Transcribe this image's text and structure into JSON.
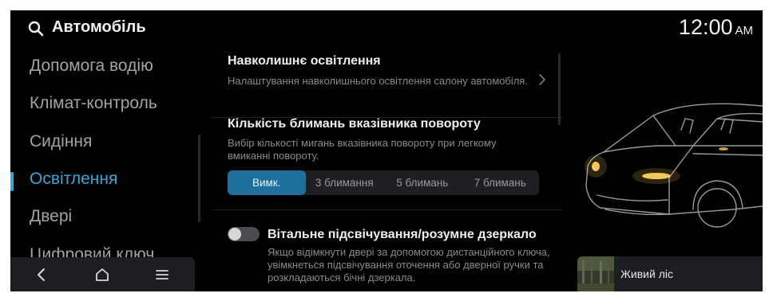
{
  "header": {
    "title": "Автомобіль",
    "time": "12:00",
    "ampm": "AM"
  },
  "sidebar": {
    "items": [
      {
        "label": "Допомога водію",
        "active": false
      },
      {
        "label": "Клімат-контроль",
        "active": false
      },
      {
        "label": "Сидіння",
        "active": false
      },
      {
        "label": "Освітлення",
        "active": true
      },
      {
        "label": "Двері",
        "active": false
      },
      {
        "label": "Цифровий ключ",
        "active": false
      }
    ]
  },
  "settings": {
    "ambient": {
      "title": "Навколишнє освітлення",
      "description": "Налаштування навколишнього освітлення салону автомобіля."
    },
    "turn_signal": {
      "title": "Кількість блимань вказівника повороту",
      "description": "Вибір кількості мигань вказівника повороту при легкому вмиканні повороту.",
      "options": [
        "Вимк.",
        "3 блимання",
        "5 блимань",
        "7 блимань"
      ],
      "selected": "Вимк."
    },
    "welcome_light": {
      "title": "Вітальне підсвічування/розумне дзеркало",
      "description": "Якщо відімкнути двері за допомогою дистанційного ключа, увімкнеться підсвічування оточення або дверної ручки та розкладаються бічні дзеркала.",
      "enabled": false
    }
  },
  "media": {
    "title": "Живий ліс"
  },
  "colors": {
    "accent": "#3ba6d6",
    "selected_segment": "#1f6f9c",
    "background": "#000000",
    "headlight": "#f3c95a"
  },
  "icons": {
    "search": "search-icon",
    "chevron": "chevron-right-icon",
    "back": "back-icon",
    "home": "home-icon",
    "menu": "menu-icon"
  }
}
